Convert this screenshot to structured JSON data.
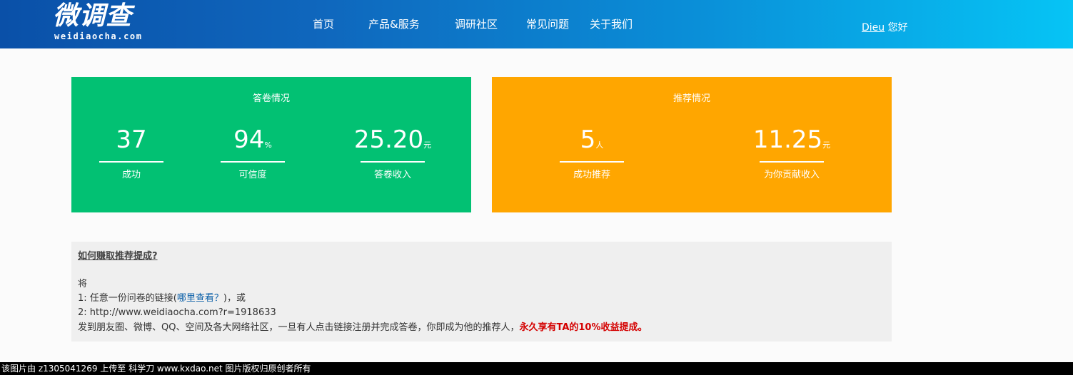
{
  "header": {
    "logo_main": "微调查",
    "logo_sub": "weidiaocha.com",
    "nav": [
      {
        "label": "首页"
      },
      {
        "label": "产品&服务"
      },
      {
        "label": "调研社区"
      },
      {
        "label": "常见问题"
      },
      {
        "label": "关于我们"
      }
    ],
    "user_name": "Dieu",
    "greeting": "您好"
  },
  "answer_card": {
    "title": "答卷情况",
    "stats": [
      {
        "value": "37",
        "unit": "",
        "label": "成功"
      },
      {
        "value": "94",
        "unit": "%",
        "label": "可信度"
      },
      {
        "value": "25.20",
        "unit": "元",
        "label": "答卷收入"
      }
    ],
    "color": "#02c173"
  },
  "referral_card": {
    "title": "推荐情况",
    "stats": [
      {
        "value": "5",
        "unit": "人",
        "label": "成功推荐"
      },
      {
        "value": "11.25",
        "unit": "元",
        "label": "为你贡献收入"
      }
    ],
    "color": "#ffa600"
  },
  "info": {
    "question": "如何赚取推荐提成?",
    "intro": "将",
    "line1_prefix": "1: 任意一份问卷的链接(",
    "line1_link": "哪里查看？",
    "line1_suffix": ")，或",
    "line2": "2: http://www.weidiaocha.com?r=1918633",
    "line3_prefix": "发到朋友圈、微博、QQ、空间及各大网络社区，一旦有人点击链接注册并完成答卷，你即成为他的推荐人，",
    "line3_highlight": "永久享有TA的10%收益提成。"
  },
  "footer": {
    "text": "该图片由 z1305041269 上传至 科学刀 www.kxdao.net 图片版权归原创者所有"
  }
}
